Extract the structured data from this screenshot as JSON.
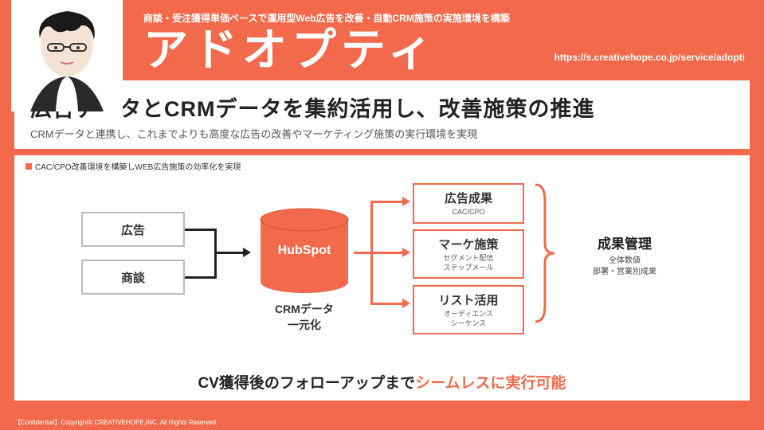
{
  "header": {
    "tagline": "商談・受注獲得単価ベースで運用型Web広告を改善・自動CRM施策の実施環境を構築",
    "brand": "アドオプティ",
    "url": "https://s.creativehope.co.jp/service/adopti"
  },
  "title": {
    "main": "広告データとCRMデータを集約活用し、改善施策の推進",
    "sub": "CRMデータと連携し、これまでよりも高度な広告の改善やマーケティング施策の実行環境を実現"
  },
  "diagram": {
    "caption": "CAC/CPO改善環境を構築しWEB広告施策の効率化を実現",
    "inputs": [
      "広告",
      "商談"
    ],
    "hub": {
      "logo": "HubSpot",
      "label": "CRMデータ\n一元化"
    },
    "outputs": [
      {
        "title": "広告成果",
        "sub": "CAC/CPO"
      },
      {
        "title": "マーケ施策",
        "sub": "セグメント配信\nステップメール"
      },
      {
        "title": "リスト活用",
        "sub": "オーディエンス\nシーケンス"
      }
    ],
    "result": {
      "title": "成果管理",
      "sub": "全体数値\n部署・営業別成果"
    },
    "bottom_black": "CV獲得後のフォローアップまで",
    "bottom_orange": "シームレスに実行可能"
  },
  "footer": "【Confidential】Copyright© CREATIVEHOPE,INC. All Rights Reserved."
}
